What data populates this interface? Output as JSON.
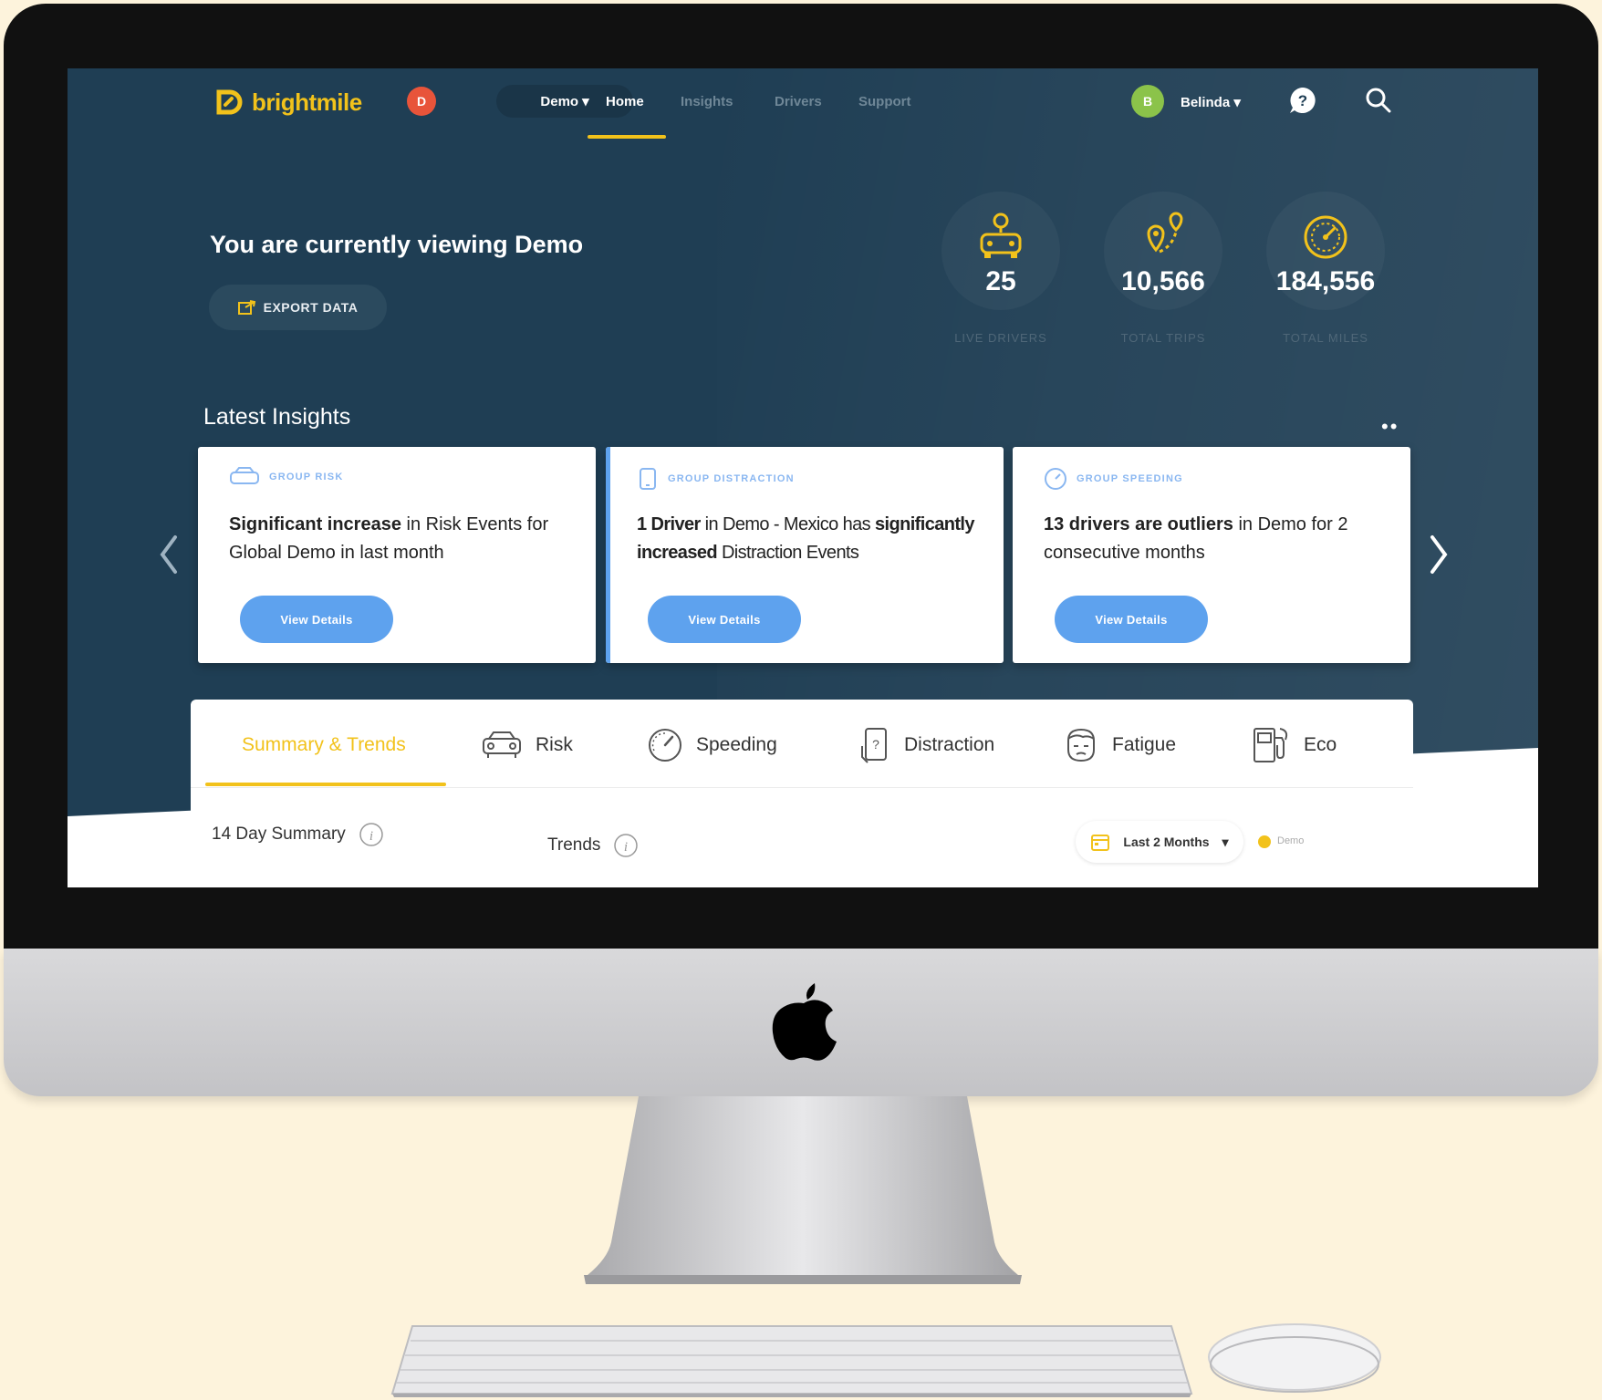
{
  "brand": {
    "name": "brightmile",
    "color": "#f2c21b"
  },
  "nav": {
    "org_initial": "D",
    "org_select": "Demo",
    "links": [
      "Home",
      "Insights",
      "Drivers",
      "Support"
    ],
    "active_link": "Home",
    "user_initial": "B",
    "user_name": "Belinda",
    "icons": [
      "chevron-down-icon",
      "help-chat-icon",
      "search-icon"
    ]
  },
  "hero": {
    "title": "You are currently viewing Demo",
    "export_label": "EXPORT DATA"
  },
  "stats": [
    {
      "value": "25",
      "label": "LIVE DRIVERS",
      "icon": "car-pin-icon"
    },
    {
      "value": "10,566",
      "label": "TOTAL TRIPS",
      "icon": "route-icon"
    },
    {
      "value": "184,556",
      "label": "TOTAL MILES",
      "icon": "speedometer-icon"
    }
  ],
  "insights": {
    "title": "Latest Insights",
    "cards": [
      {
        "tag": "GROUP RISK",
        "icon": "car-icon",
        "bold1": "Significant increase",
        "text1": " in Risk Events for Global Demo in last month",
        "button": "View Details"
      },
      {
        "tag": "GROUP DISTRACTION",
        "icon": "phone-icon",
        "bold1": "1 Driver",
        "text1": " in Demo - Mexico has ",
        "bold2": "significantly increased",
        "text2": " Distraction Events",
        "button": "View Details"
      },
      {
        "tag": "GROUP SPEEDING",
        "icon": "speed-icon",
        "bold1": "13 drivers are outliers",
        "text1": " in Demo for 2 consecutive months",
        "button": "View Details"
      }
    ]
  },
  "tabs": {
    "items": [
      "Summary & Trends",
      "Risk",
      "Speeding",
      "Distraction",
      "Fatigue",
      "Eco"
    ],
    "active": "Summary & Trends",
    "summary_label": "14 Day Summary",
    "trends_label": "Trends",
    "range": "Last 2 Months",
    "legend": "Demo"
  },
  "colors": {
    "background": "#1f3e54",
    "accent": "#f2c21b",
    "button_blue": "#5ea2ee",
    "page_bg": "#fdf3dc"
  }
}
